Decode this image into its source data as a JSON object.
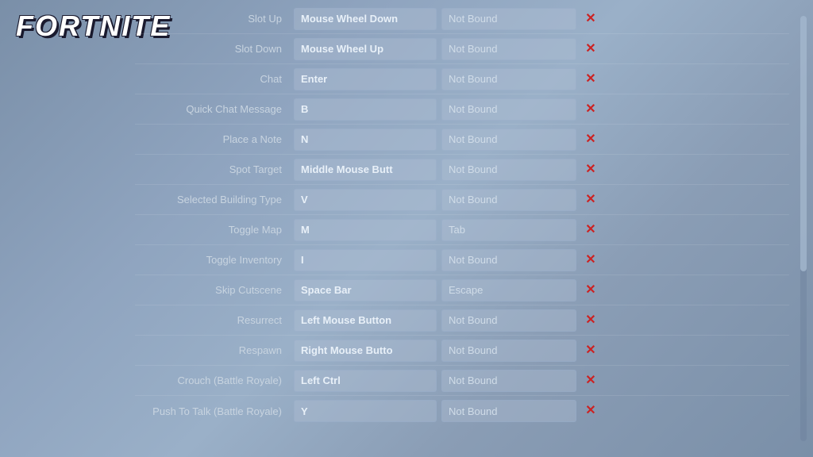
{
  "logo": {
    "text": "FORTNITE"
  },
  "keybindings": [
    {
      "action": "Slot Up",
      "primary": "Mouse Wheel Down",
      "secondary": "Not Bound",
      "primary_bold": true
    },
    {
      "action": "Slot Down",
      "primary": "Mouse Wheel Up",
      "secondary": "Not Bound",
      "primary_bold": true
    },
    {
      "action": "Chat",
      "primary": "Enter",
      "secondary": "Not Bound",
      "primary_bold": true
    },
    {
      "action": "Quick Chat Message",
      "primary": "B",
      "secondary": "Not Bound",
      "primary_bold": true
    },
    {
      "action": "Place a Note",
      "primary": "N",
      "secondary": "Not Bound",
      "primary_bold": true
    },
    {
      "action": "Spot Target",
      "primary": "Middle Mouse Butt",
      "secondary": "Not Bound",
      "primary_bold": true
    },
    {
      "action": "Selected Building Type",
      "primary": "V",
      "secondary": "Not Bound",
      "primary_bold": true
    },
    {
      "action": "Toggle Map",
      "primary": "M",
      "secondary": "Tab",
      "primary_bold": true
    },
    {
      "action": "Toggle Inventory",
      "primary": "I",
      "secondary": "Not Bound",
      "primary_bold": true
    },
    {
      "action": "Skip Cutscene",
      "primary": "Space Bar",
      "secondary": "Escape",
      "primary_bold": true
    },
    {
      "action": "Resurrect",
      "primary": "Left Mouse Button",
      "secondary": "Not Bound",
      "primary_bold": true
    },
    {
      "action": "Respawn",
      "primary": "Right Mouse Butto",
      "secondary": "Not Bound",
      "primary_bold": true
    },
    {
      "action": "Crouch (Battle Royale)",
      "primary": "Left Ctrl",
      "secondary": "Not Bound",
      "primary_bold": true
    },
    {
      "action": "Push To Talk (Battle Royale)",
      "primary": "Y",
      "secondary": "Not Bound",
      "primary_bold": true
    }
  ],
  "icons": {
    "reset": "×"
  }
}
